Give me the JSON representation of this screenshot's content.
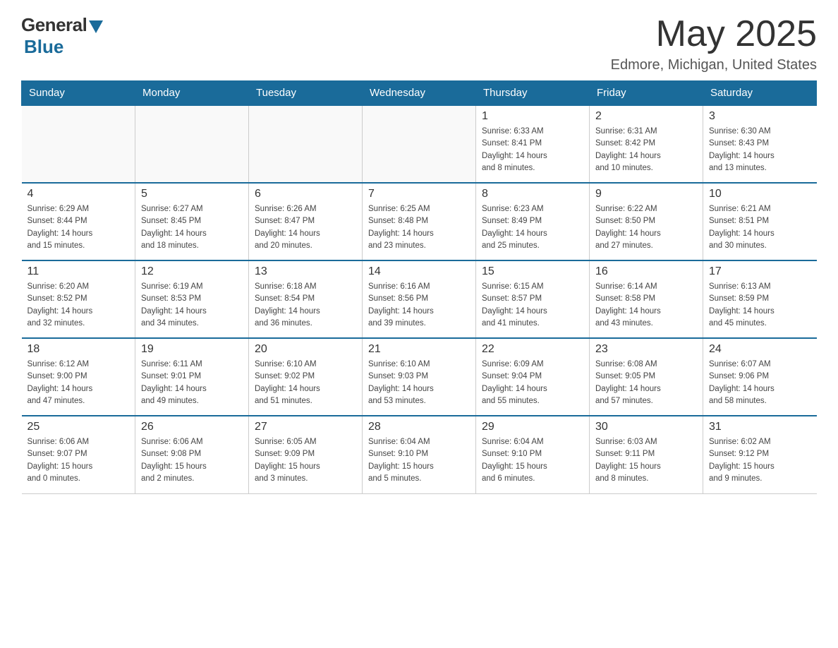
{
  "header": {
    "logo_general": "General",
    "logo_blue": "Blue",
    "month_title": "May 2025",
    "location": "Edmore, Michigan, United States"
  },
  "days_of_week": [
    "Sunday",
    "Monday",
    "Tuesday",
    "Wednesday",
    "Thursday",
    "Friday",
    "Saturday"
  ],
  "weeks": [
    [
      {
        "day": "",
        "info": ""
      },
      {
        "day": "",
        "info": ""
      },
      {
        "day": "",
        "info": ""
      },
      {
        "day": "",
        "info": ""
      },
      {
        "day": "1",
        "info": "Sunrise: 6:33 AM\nSunset: 8:41 PM\nDaylight: 14 hours\nand 8 minutes."
      },
      {
        "day": "2",
        "info": "Sunrise: 6:31 AM\nSunset: 8:42 PM\nDaylight: 14 hours\nand 10 minutes."
      },
      {
        "day": "3",
        "info": "Sunrise: 6:30 AM\nSunset: 8:43 PM\nDaylight: 14 hours\nand 13 minutes."
      }
    ],
    [
      {
        "day": "4",
        "info": "Sunrise: 6:29 AM\nSunset: 8:44 PM\nDaylight: 14 hours\nand 15 minutes."
      },
      {
        "day": "5",
        "info": "Sunrise: 6:27 AM\nSunset: 8:45 PM\nDaylight: 14 hours\nand 18 minutes."
      },
      {
        "day": "6",
        "info": "Sunrise: 6:26 AM\nSunset: 8:47 PM\nDaylight: 14 hours\nand 20 minutes."
      },
      {
        "day": "7",
        "info": "Sunrise: 6:25 AM\nSunset: 8:48 PM\nDaylight: 14 hours\nand 23 minutes."
      },
      {
        "day": "8",
        "info": "Sunrise: 6:23 AM\nSunset: 8:49 PM\nDaylight: 14 hours\nand 25 minutes."
      },
      {
        "day": "9",
        "info": "Sunrise: 6:22 AM\nSunset: 8:50 PM\nDaylight: 14 hours\nand 27 minutes."
      },
      {
        "day": "10",
        "info": "Sunrise: 6:21 AM\nSunset: 8:51 PM\nDaylight: 14 hours\nand 30 minutes."
      }
    ],
    [
      {
        "day": "11",
        "info": "Sunrise: 6:20 AM\nSunset: 8:52 PM\nDaylight: 14 hours\nand 32 minutes."
      },
      {
        "day": "12",
        "info": "Sunrise: 6:19 AM\nSunset: 8:53 PM\nDaylight: 14 hours\nand 34 minutes."
      },
      {
        "day": "13",
        "info": "Sunrise: 6:18 AM\nSunset: 8:54 PM\nDaylight: 14 hours\nand 36 minutes."
      },
      {
        "day": "14",
        "info": "Sunrise: 6:16 AM\nSunset: 8:56 PM\nDaylight: 14 hours\nand 39 minutes."
      },
      {
        "day": "15",
        "info": "Sunrise: 6:15 AM\nSunset: 8:57 PM\nDaylight: 14 hours\nand 41 minutes."
      },
      {
        "day": "16",
        "info": "Sunrise: 6:14 AM\nSunset: 8:58 PM\nDaylight: 14 hours\nand 43 minutes."
      },
      {
        "day": "17",
        "info": "Sunrise: 6:13 AM\nSunset: 8:59 PM\nDaylight: 14 hours\nand 45 minutes."
      }
    ],
    [
      {
        "day": "18",
        "info": "Sunrise: 6:12 AM\nSunset: 9:00 PM\nDaylight: 14 hours\nand 47 minutes."
      },
      {
        "day": "19",
        "info": "Sunrise: 6:11 AM\nSunset: 9:01 PM\nDaylight: 14 hours\nand 49 minutes."
      },
      {
        "day": "20",
        "info": "Sunrise: 6:10 AM\nSunset: 9:02 PM\nDaylight: 14 hours\nand 51 minutes."
      },
      {
        "day": "21",
        "info": "Sunrise: 6:10 AM\nSunset: 9:03 PM\nDaylight: 14 hours\nand 53 minutes."
      },
      {
        "day": "22",
        "info": "Sunrise: 6:09 AM\nSunset: 9:04 PM\nDaylight: 14 hours\nand 55 minutes."
      },
      {
        "day": "23",
        "info": "Sunrise: 6:08 AM\nSunset: 9:05 PM\nDaylight: 14 hours\nand 57 minutes."
      },
      {
        "day": "24",
        "info": "Sunrise: 6:07 AM\nSunset: 9:06 PM\nDaylight: 14 hours\nand 58 minutes."
      }
    ],
    [
      {
        "day": "25",
        "info": "Sunrise: 6:06 AM\nSunset: 9:07 PM\nDaylight: 15 hours\nand 0 minutes."
      },
      {
        "day": "26",
        "info": "Sunrise: 6:06 AM\nSunset: 9:08 PM\nDaylight: 15 hours\nand 2 minutes."
      },
      {
        "day": "27",
        "info": "Sunrise: 6:05 AM\nSunset: 9:09 PM\nDaylight: 15 hours\nand 3 minutes."
      },
      {
        "day": "28",
        "info": "Sunrise: 6:04 AM\nSunset: 9:10 PM\nDaylight: 15 hours\nand 5 minutes."
      },
      {
        "day": "29",
        "info": "Sunrise: 6:04 AM\nSunset: 9:10 PM\nDaylight: 15 hours\nand 6 minutes."
      },
      {
        "day": "30",
        "info": "Sunrise: 6:03 AM\nSunset: 9:11 PM\nDaylight: 15 hours\nand 8 minutes."
      },
      {
        "day": "31",
        "info": "Sunrise: 6:02 AM\nSunset: 9:12 PM\nDaylight: 15 hours\nand 9 minutes."
      }
    ]
  ]
}
